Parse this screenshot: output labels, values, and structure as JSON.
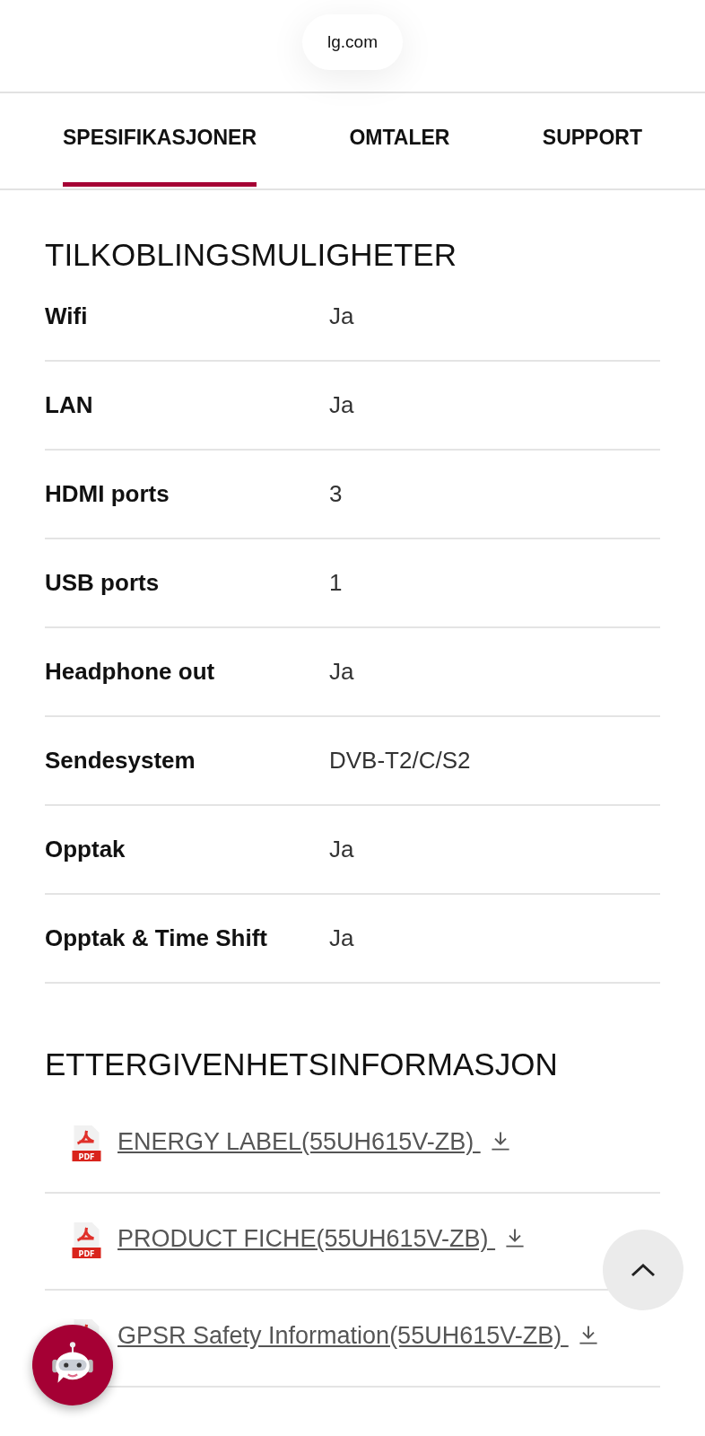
{
  "address_bar": {
    "url": "lg.com"
  },
  "tabs": [
    {
      "label": "SPESIFIKASJONER",
      "selected": true
    },
    {
      "label": "OMTALER",
      "selected": false
    },
    {
      "label": "SUPPORT",
      "selected": false
    }
  ],
  "connectivity": {
    "title": "TILKOBLINGSMULIGHETER",
    "rows": [
      {
        "label": "Wifi",
        "value": "Ja"
      },
      {
        "label": "LAN",
        "value": "Ja"
      },
      {
        "label": "HDMI ports",
        "value": "3"
      },
      {
        "label": "USB ports",
        "value": "1"
      },
      {
        "label": "Headphone out",
        "value": "Ja"
      },
      {
        "label": "Sendesystem",
        "value": "DVB-T2/C/S2"
      },
      {
        "label": "Opptak",
        "value": "Ja"
      },
      {
        "label": "Opptak & Time Shift",
        "value": "Ja"
      }
    ]
  },
  "compliance": {
    "title": "ETTERGIVENHETSINFORMASJON",
    "documents": [
      {
        "label": "ENERGY LABEL(55UH615V-ZB)",
        "icon_text": "PDF"
      },
      {
        "label": "PRODUCT FICHE(55UH615V-ZB)",
        "icon_text": "PDF"
      },
      {
        "label": "GPSR Safety Information(55UH615V-ZB)"
      }
    ]
  }
}
